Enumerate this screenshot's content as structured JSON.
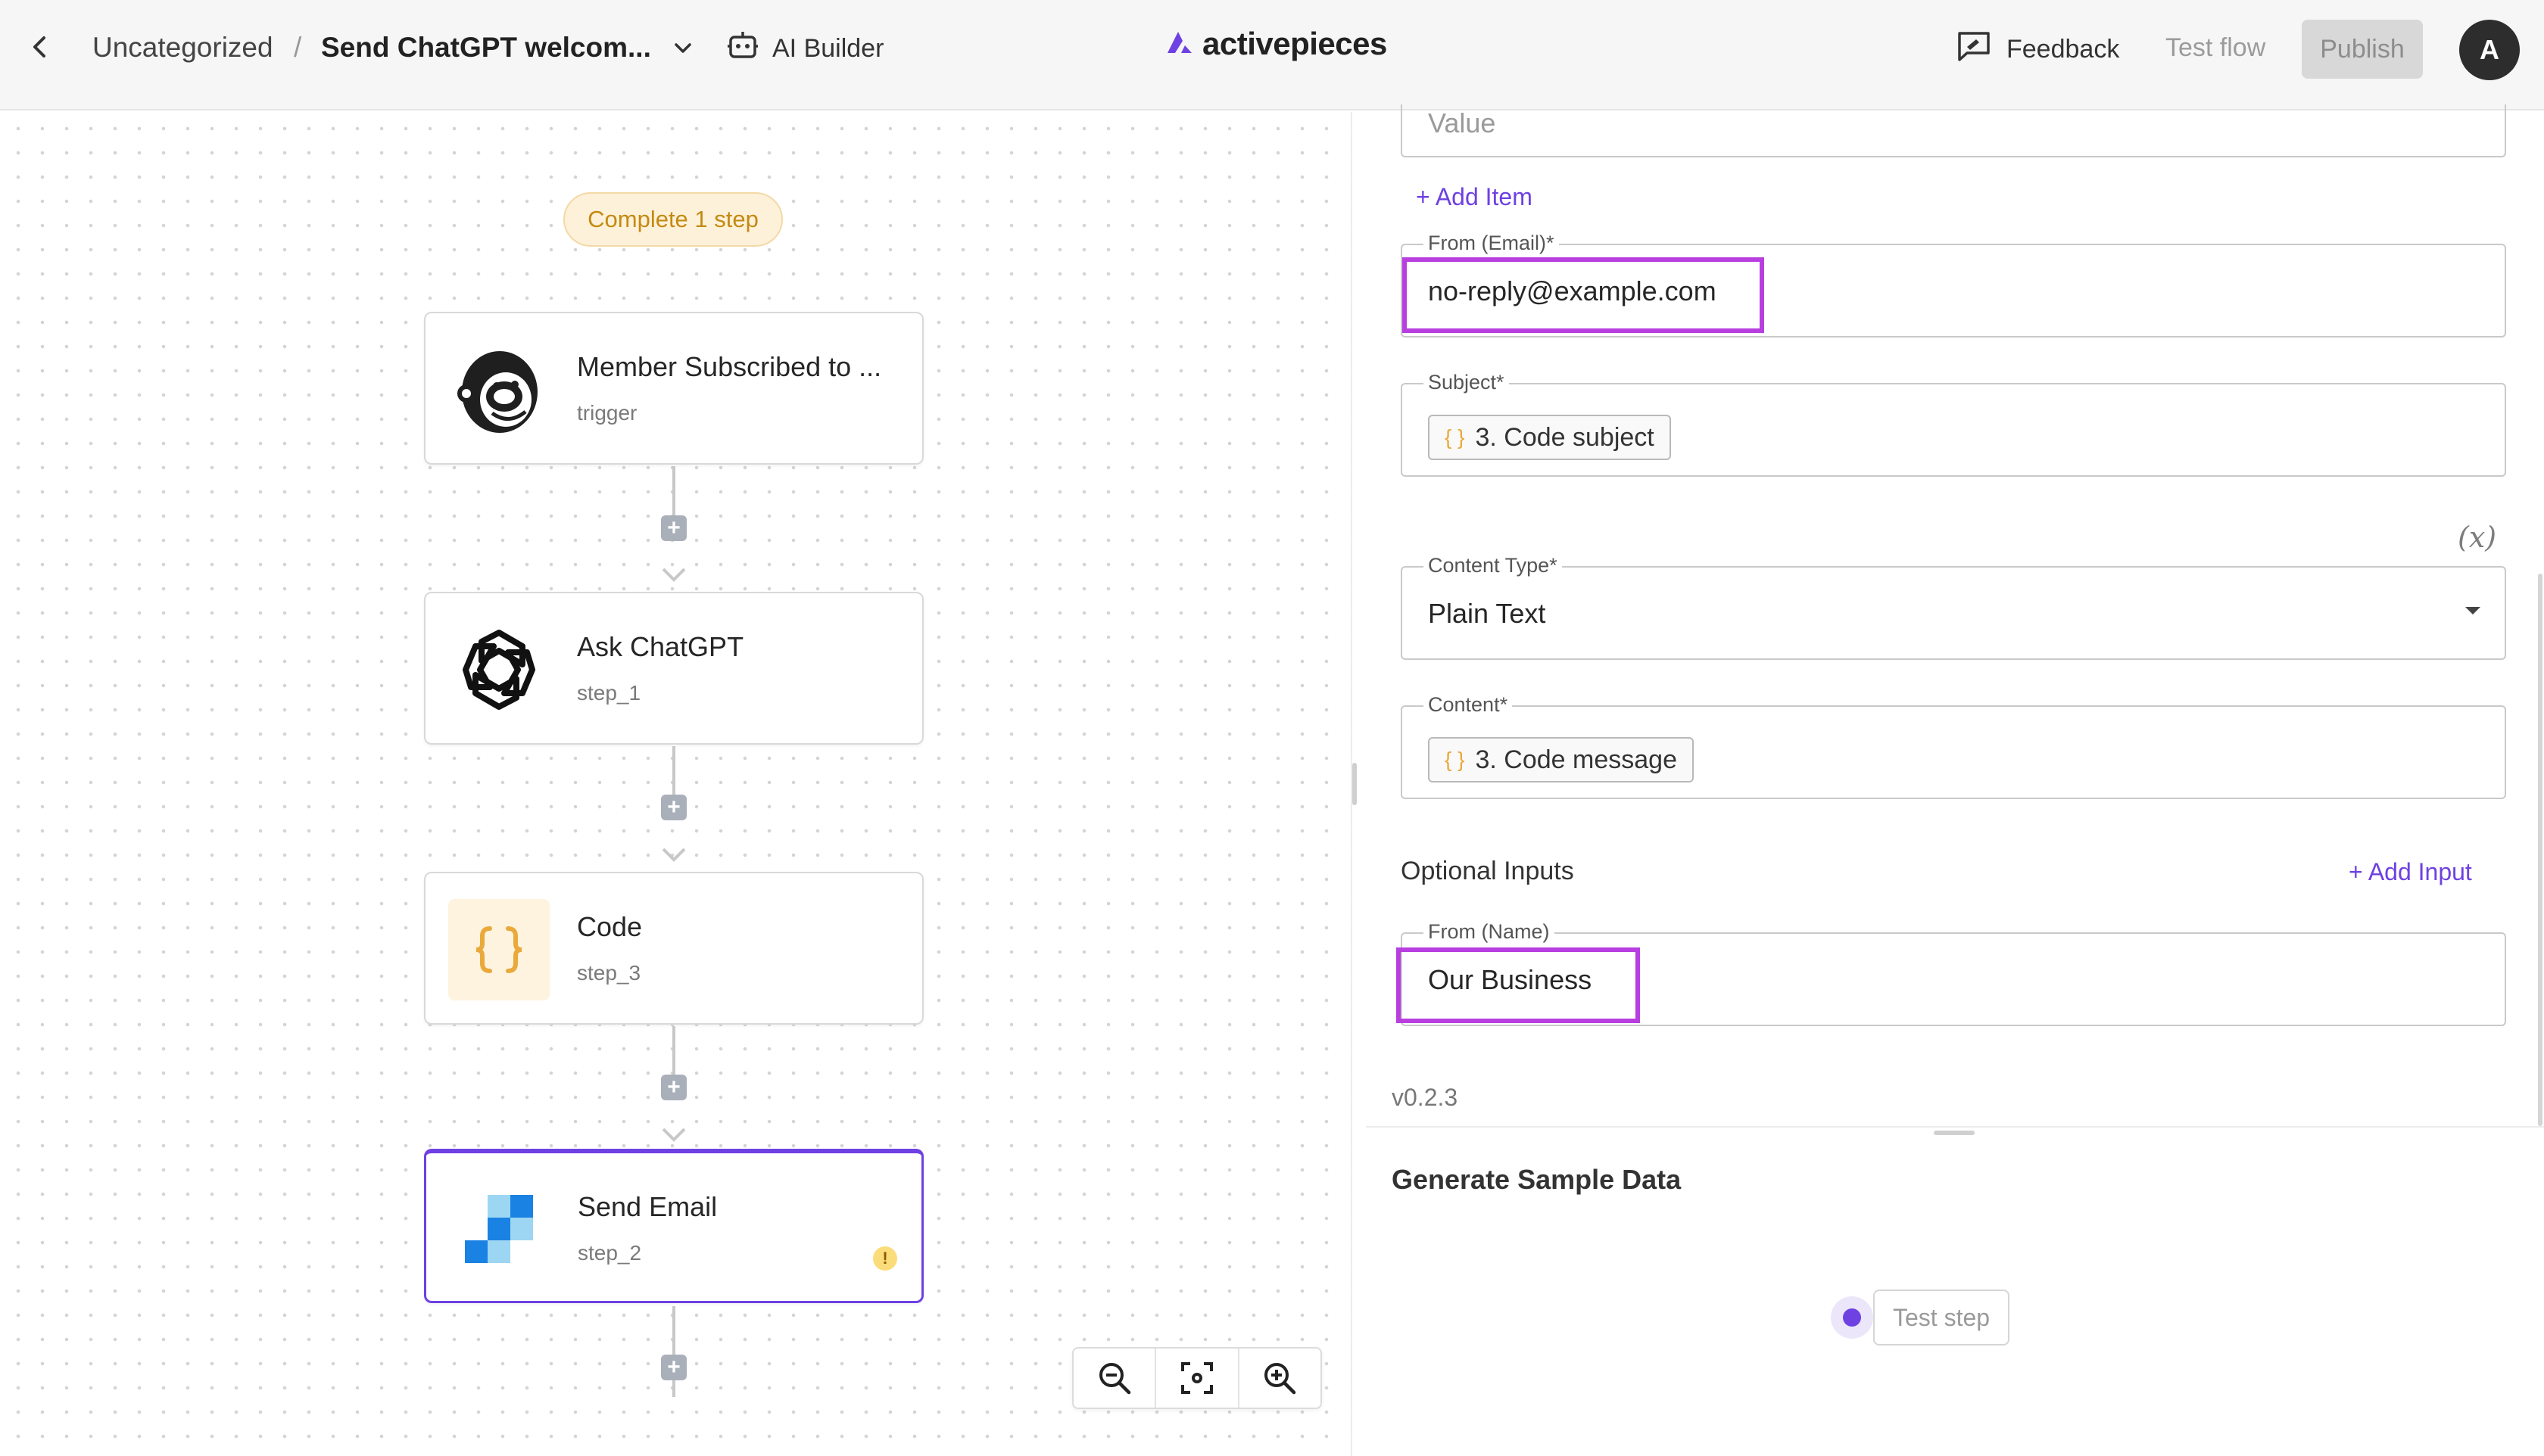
{
  "header": {
    "breadcrumb_folder": "Uncategorized",
    "breadcrumb_separator": "/",
    "flow_name": "Send ChatGPT welcom...",
    "ai_builder_label": "AI Builder",
    "logo_text": "activepieces",
    "feedback_label": "Feedback",
    "test_flow_label": "Test flow",
    "publish_label": "Publish",
    "avatar_initial": "A"
  },
  "canvas": {
    "status_badge": "Complete 1 step",
    "steps": [
      {
        "title": "Member Subscribed to ...",
        "subtitle": "trigger",
        "icon": "mailchimp-icon"
      },
      {
        "title": "Ask ChatGPT",
        "subtitle": "step_1",
        "icon": "openai-icon"
      },
      {
        "title": "Code",
        "subtitle": "step_3",
        "icon": "code-braces-icon"
      },
      {
        "title": "Send Email",
        "subtitle": "step_2",
        "icon": "sendgrid-icon",
        "warning": true
      }
    ],
    "zoom_controls": [
      "zoom-out-icon",
      "fit-view-icon",
      "zoom-in-icon"
    ]
  },
  "panel": {
    "value_placeholder": "Value",
    "add_item_label": "+ Add Item",
    "from_email": {
      "label": "From (Email)*",
      "value": "no-reply@example.com"
    },
    "subject": {
      "label": "Subject*",
      "chip": "3. Code subject"
    },
    "fx_label": "(x)",
    "content_type": {
      "label": "Content Type*",
      "value": "Plain Text"
    },
    "content": {
      "label": "Content*",
      "chip": "3. Code message"
    },
    "optional_inputs_title": "Optional Inputs",
    "add_input_label": "+ Add Input",
    "from_name": {
      "label": "From (Name)",
      "value": "Our Business"
    },
    "version": "v0.2.3",
    "sample_data_title": "Generate Sample Data",
    "test_step_label": "Test step"
  },
  "colors": {
    "accent": "#6e41e2",
    "highlight": "#b83ee0",
    "badge_bg": "#fdf1d9",
    "badge_text": "#c48a12"
  }
}
